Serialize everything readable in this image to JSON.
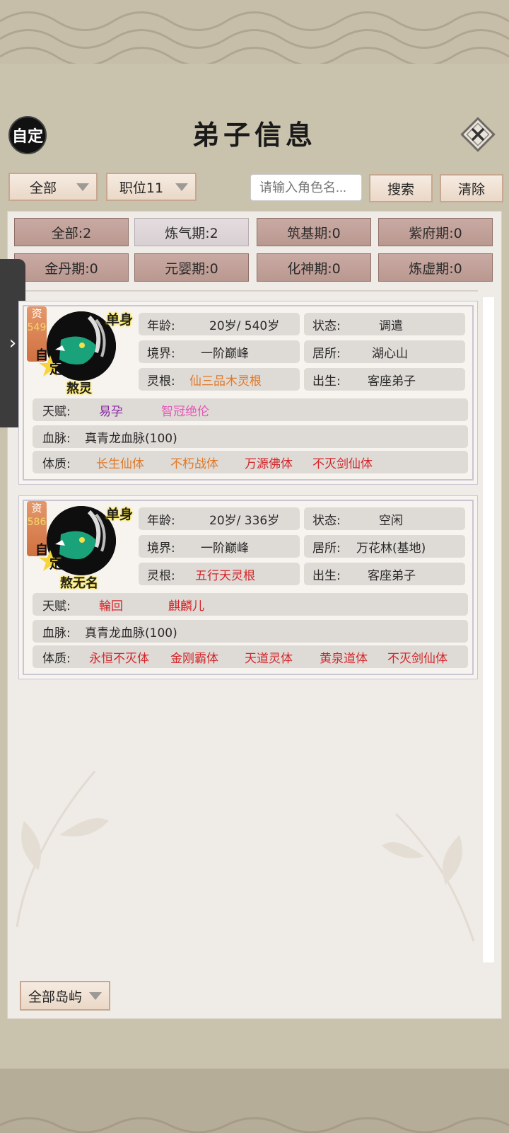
{
  "header": {
    "title": "弟子信息",
    "custom_label": "自定"
  },
  "filters": {
    "category": "全部",
    "position": "职位11",
    "search_placeholder": "请输入角色名...",
    "search_label": "搜索",
    "clear_label": "清除"
  },
  "stages": [
    {
      "label": "全部:2"
    },
    {
      "label": "炼气期:2"
    },
    {
      "label": "筑基期:0"
    },
    {
      "label": "紫府期:0"
    },
    {
      "label": "金丹期:0"
    },
    {
      "label": "元婴期:0"
    },
    {
      "label": "化神期:0"
    },
    {
      "label": "炼虚期:0"
    }
  ],
  "disciples": [
    {
      "zi": "资",
      "aptitude": "549",
      "ding": "定",
      "zi_mark": "自",
      "marital": "单身",
      "name": "熬灵",
      "age_label": "年龄:",
      "age": "20岁/ 540岁",
      "status_label": "状态:",
      "status": "调遣",
      "realm_label": "境界:",
      "realm": "一阶巅峰",
      "residence_label": "居所:",
      "residence": "湖心山",
      "root_label": "灵根:",
      "root": "仙三品木灵根",
      "birth_label": "出生:",
      "birth": "客座弟子",
      "talent_label": "天赋:",
      "talents": [
        "易孕",
        "智冠绝伦"
      ],
      "bloodline_label": "血脉:",
      "bloodline": "真青龙血脉(100)",
      "physique_label": "体质:",
      "physiques": [
        "长生仙体",
        "不朽战体",
        "万源佛体",
        "不灭剑仙体"
      ]
    },
    {
      "zi": "资",
      "aptitude": "586",
      "ding": "定",
      "zi_mark": "自",
      "marital": "单身",
      "name": "熬无名",
      "age_label": "年龄:",
      "age": "20岁/ 336岁",
      "status_label": "状态:",
      "status": "空闲",
      "realm_label": "境界:",
      "realm": "一阶巅峰",
      "residence_label": "居所:",
      "residence": "万花林(基地)",
      "root_label": "灵根:",
      "root": "五行天灵根",
      "birth_label": "出生:",
      "birth": "客座弟子",
      "talent_label": "天赋:",
      "talents": [
        "輪回",
        "麒麟儿"
      ],
      "bloodline_label": "血脉:",
      "bloodline": "真青龙血脉(100)",
      "physique_label": "体质:",
      "physiques": [
        "永恒不灭体",
        "金刚霸体",
        "天道灵体",
        "黄泉道体",
        "不灭剑仙体"
      ]
    }
  ],
  "footer": {
    "island_filter": "全部岛屿"
  },
  "colors": {
    "background": "#b6ad98",
    "content": "#efebe6",
    "stage_button": "#c9aaa2",
    "trait_red": "#d4262a",
    "trait_orange": "#e07a2a",
    "trait_purple": "#8a2aa6",
    "trait_pink": "#e45ab8"
  },
  "icons": [
    "close-icon",
    "chevron-right-icon",
    "dropdown-arrow-icon",
    "dragon-avatar-icon"
  ]
}
